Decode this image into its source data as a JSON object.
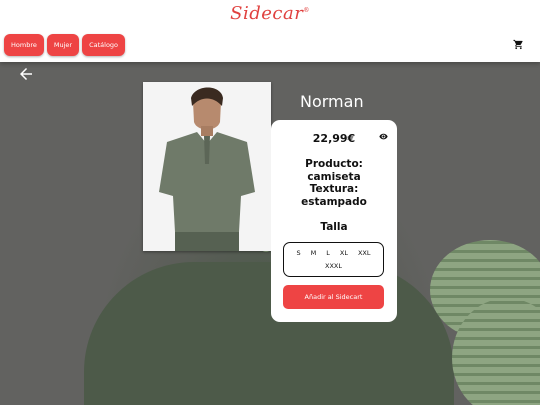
{
  "header": {
    "logo_text": "Sidecar",
    "logo_mark": "®",
    "nav": [
      "Hombre",
      "Mujer",
      "Catálogo"
    ],
    "cart_icon": "cart-icon"
  },
  "hero": {
    "back_icon": "arrow-left-icon"
  },
  "product": {
    "name": "Norman",
    "price": "22,99€",
    "eye_icon": "eye-icon",
    "desc_lines": [
      "Producto:",
      "camiseta",
      "Textura:",
      "estampado"
    ],
    "size_title": "Talla",
    "sizes": [
      "S",
      "M",
      "L",
      "XL",
      "XXL",
      "XXXL"
    ],
    "add_button": "Añadir al Sidecart"
  },
  "colors": {
    "accent": "#ee4444",
    "logo": "#e0413f",
    "shirt_green": "#4d5a49"
  }
}
